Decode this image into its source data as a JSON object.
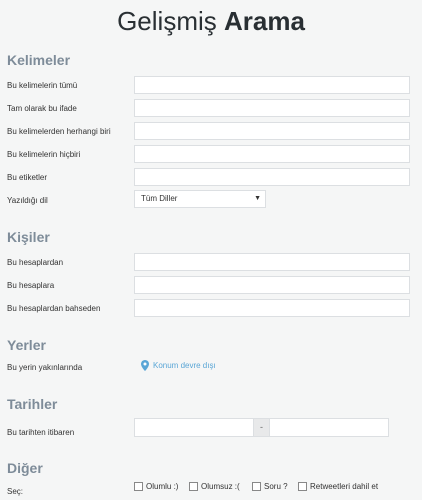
{
  "header": {
    "title_light": "Gelişmiş",
    "title_bold": "Arama"
  },
  "words": {
    "heading": "Kelimeler",
    "all": "Bu kelimelerin tümü",
    "exact": "Tam olarak bu ifade",
    "any": "Bu kelimelerden herhangi biri",
    "none": "Bu kelimelerin hiçbiri",
    "tags": "Bu etiketler",
    "lang_label": "Yazıldığı dil",
    "lang_value": "Tüm Diller"
  },
  "people": {
    "heading": "Kişiler",
    "from": "Bu hesaplardan",
    "to": "Bu hesaplara",
    "mention": "Bu hesaplardan bahseden"
  },
  "places": {
    "heading": "Yerler",
    "near": "Bu yerin yakınlarında",
    "location": "Konum devre dışı"
  },
  "dates": {
    "heading": "Tarihler",
    "since": "Bu tarihten itibaren",
    "separator": "-"
  },
  "other": {
    "heading": "Diğer",
    "select": "Seç:",
    "positive": "Olumlu :)",
    "negative": "Olumsuz :(",
    "question": "Soru ?",
    "retweets": "Retweetleri dahil et"
  }
}
